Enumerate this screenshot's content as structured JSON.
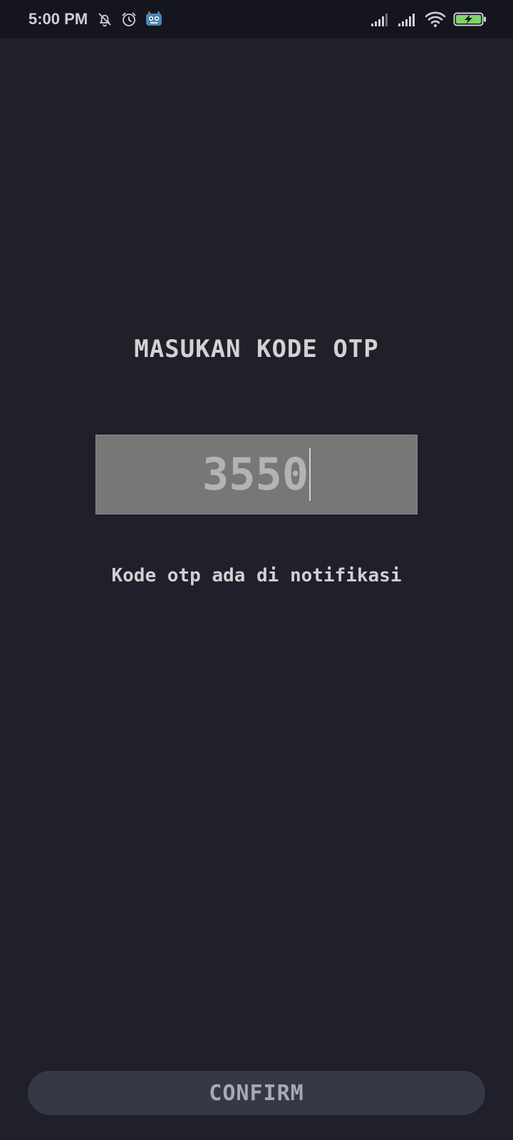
{
  "status_bar": {
    "time": "5:00 PM",
    "left_icons": [
      "bell-off-icon",
      "alarm-icon",
      "app-icon"
    ],
    "right_icons": [
      "signal-icon",
      "signal-icon",
      "wifi-icon",
      "battery-charging-icon"
    ],
    "battery_color": "#7ed36a"
  },
  "main": {
    "title": "MASUKAN KODE OTP",
    "otp_input": {
      "value": "3550"
    },
    "hint": "Kode otp ada di notifikasi"
  },
  "footer": {
    "confirm_label": "CONFIRM"
  },
  "colors": {
    "background": "#1f2029",
    "status_bar": "#15161d",
    "input_bg": "#777777",
    "button_bg": "#363848",
    "text": "#d2d2d2"
  }
}
